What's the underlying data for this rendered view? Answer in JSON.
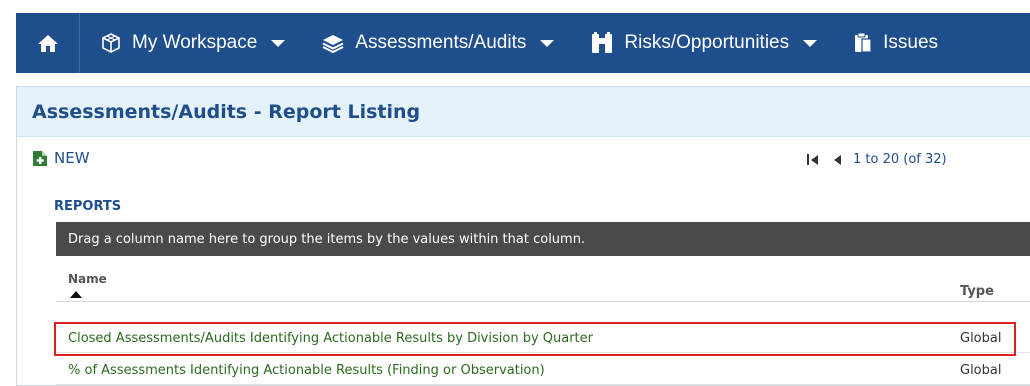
{
  "nav": {
    "items": [
      {
        "label": "My Workspace",
        "icon": "cube-icon"
      },
      {
        "label": "Assessments/Audits",
        "icon": "layers-icon"
      },
      {
        "label": "Risks/Opportunities",
        "icon": "binoculars-icon"
      },
      {
        "label": "Issues",
        "icon": "clipboard-icon"
      }
    ],
    "home_icon": "home-icon",
    "bg_color": "#1f4e8c"
  },
  "panel": {
    "title": "Assessments/Audits - Report Listing"
  },
  "toolbar": {
    "new_label": "NEW",
    "pager_text": "1 to 20 (of 32)"
  },
  "reports": {
    "section_label": "REPORTS",
    "group_hint": "Drag a column name here to group the items by the values within that column.",
    "columns": {
      "name": "Name",
      "type": "Type"
    },
    "rows": [
      {
        "name": "Closed Assessments/Audits Identifying Actionable Results by Division by Quarter",
        "type": "Global"
      },
      {
        "name": "% of Assessments Identifying Actionable Results (Finding or Observation)",
        "type": "Global"
      }
    ]
  },
  "colors": {
    "accent": "#1f4e8c",
    "link_green": "#2c6a1e",
    "highlight_red": "#e02020",
    "header_bg": "#e6f2f9",
    "group_bar": "#4a4a4a"
  }
}
